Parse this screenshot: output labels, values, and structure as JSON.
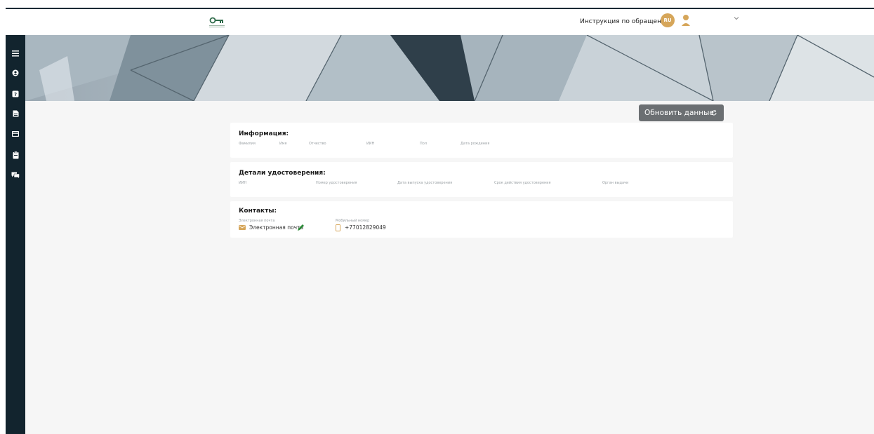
{
  "header": {
    "logo_icon": "key-logo-icon",
    "instruction_link": "Инструкция по обращениям",
    "language_badge": "RU",
    "user_icon": "user-icon",
    "dropdown_icon": "chevron-down-icon"
  },
  "sidebar": {
    "items": [
      {
        "icon": "menu-icon"
      },
      {
        "icon": "profile-icon"
      },
      {
        "icon": "help-icon"
      },
      {
        "icon": "document-icon"
      },
      {
        "icon": "card-icon"
      },
      {
        "icon": "clipboard-icon"
      },
      {
        "icon": "chat-icon"
      }
    ]
  },
  "main": {
    "refresh_button": "Обновить данные",
    "info": {
      "title": "Информация:",
      "fields": [
        "Фамилия",
        "Имя",
        "Отчество",
        "ИИН",
        "Пол",
        "Дата рождения"
      ]
    },
    "id_details": {
      "title": "Детали удостоверения:",
      "fields": [
        "ИИН",
        "Номер удостоверения",
        "Дата выпуска удостоверения",
        "Срок действия удостоверения",
        "Орган выдачи"
      ]
    },
    "contacts": {
      "title": "Контакты:",
      "email_label": "Электронная почта",
      "email_value": "Электронная почта",
      "phone_label": "Мобильный номер",
      "phone_value": "+77012829049"
    }
  },
  "colors": {
    "sidebar": "#12242e",
    "accent": "#d6a65a",
    "button": "#6b6f72",
    "background": "#f6f6f6"
  }
}
